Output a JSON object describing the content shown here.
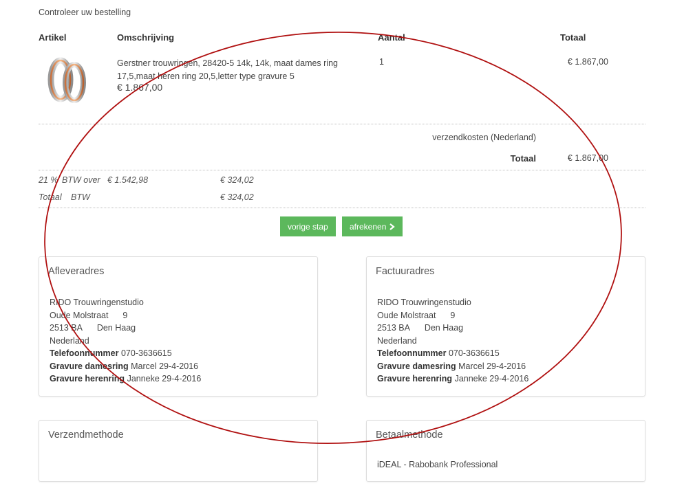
{
  "page": {
    "title": "Controleer uw bestelling"
  },
  "table": {
    "headers": {
      "artikel": "Artikel",
      "omschrijving": "Omschrijving",
      "aantal": "Aantal",
      "totaal": "Totaal"
    },
    "row": {
      "description_line1": "Gerstner trouwringen, 28420-5 14k, 14k, maat dames ring",
      "description_line2": "17,5,maat heren ring 20,5,letter type gravure 5",
      "unit_price": "€ 1.867,00",
      "quantity": "1",
      "total": "€ 1.867,00"
    }
  },
  "summary": {
    "shipping_label": "verzendkosten (Nederland)",
    "total_label": "Totaal",
    "total_value": "€ 1.867,00",
    "vat_line1_label": "21 %",
    "vat_line1_text": "BTW over",
    "vat_line1_base": "€ 1.542,98",
    "vat_line1_value": "€ 324,02",
    "vat_line2_label": "Totaal",
    "vat_line2_text": "BTW",
    "vat_line2_value": "€ 324,02"
  },
  "buttons": {
    "back": "vorige stap",
    "checkout": "afrekenen"
  },
  "delivery": {
    "title": "Afleveradres",
    "company": "RIDO Trouwringenstudio",
    "street": "Oude Molstraat",
    "number": "9",
    "postcode": "2513 BA",
    "city": "Den Haag",
    "country": "Nederland",
    "phone_label": "Telefoonnummer",
    "phone": "070-3636615",
    "engr_women_label": "Gravure damesring",
    "engr_women": "Marcel 29-4-2016",
    "engr_men_label": "Gravure herenring",
    "engr_men": "Janneke 29-4-2016"
  },
  "invoice": {
    "title": "Factuuradres",
    "company": "RIDO Trouwringenstudio",
    "street": "Oude Molstraat",
    "number": "9",
    "postcode": "2513 BA",
    "city": "Den Haag",
    "country": "Nederland",
    "phone_label": "Telefoonnummer",
    "phone": "070-3636615",
    "engr_women_label": "Gravure damesring",
    "engr_women": "Marcel 29-4-2016",
    "engr_men_label": "Gravure herenring",
    "engr_men": "Janneke 29-4-2016"
  },
  "shipping_method": {
    "title": "Verzendmethode"
  },
  "payment_method": {
    "title": "Betaalmethode",
    "value": "iDEAL - Rabobank Professional"
  },
  "colors": {
    "button": "#5cb85c",
    "annotation": "#b01010"
  }
}
